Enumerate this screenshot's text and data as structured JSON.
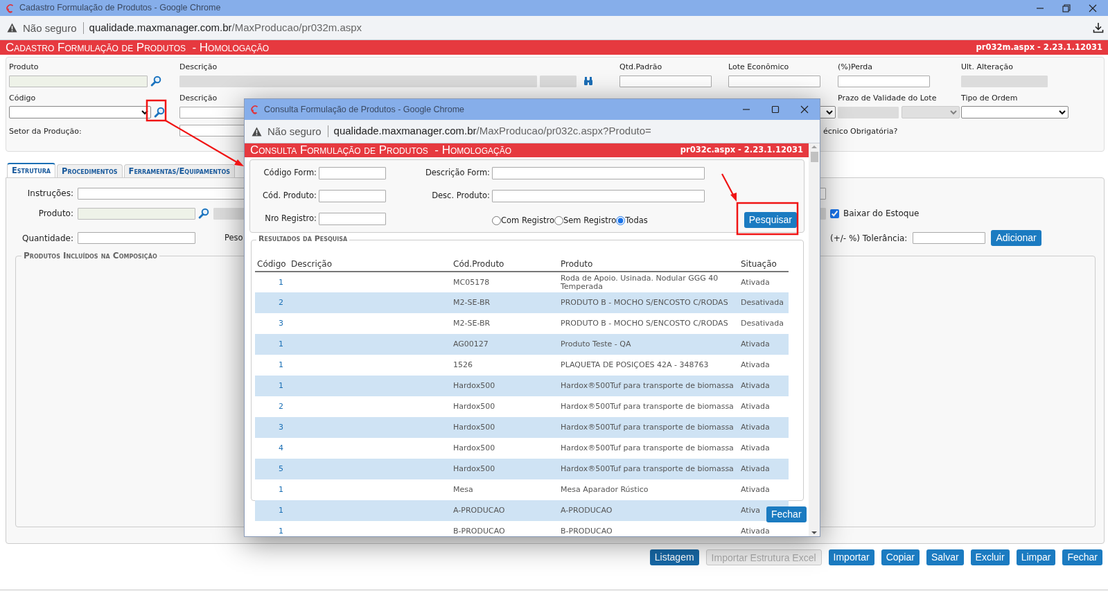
{
  "window": {
    "title": "Cadastro Formulação de Produtos - Google Chrome",
    "security": "Não seguro",
    "url_host": "qualidade.maxmanager.com.br",
    "url_path": "/MaxProducao/pr032m.aspx"
  },
  "page_header": {
    "title": "Cadastro Formulação de Produtos  - Homologação",
    "version": "pr032m.aspx - 2.23.1.12031"
  },
  "header_form": {
    "rows": [
      [
        {
          "label": "Produto",
          "kind": "lookup"
        },
        {
          "label": "Descrição",
          "kind": "readonly_pair"
        },
        {
          "label": "Qtd.Padrão",
          "kind": "text"
        },
        {
          "label": "Lote Econômico",
          "kind": "text"
        },
        {
          "label": "(%)Perda",
          "kind": "text"
        },
        {
          "label": "Ult. Alteração",
          "kind": "readonly"
        }
      ],
      [
        {
          "label": "Código",
          "kind": "select_lookup"
        },
        {
          "label": "Descrição",
          "kind": "text"
        },
        "",
        {
          "kind": "select"
        },
        {
          "label": "Prazo de Validade do Lote",
          "kind": "readonly_select"
        },
        {
          "label": "Tipo de Ordem",
          "kind": "select"
        }
      ]
    ],
    "setor_label": "Setor da Produção:",
    "partial_label": "écnico Obrigatória?"
  },
  "tabs": [
    {
      "label": "Estrutura",
      "selected": true
    },
    {
      "label": "Procedimentos",
      "selected": false
    },
    {
      "label": "Ferramentas/Equipamentos",
      "selected": false
    }
  ],
  "structure": {
    "instrucoes_label": "Instruções:",
    "produto_label": "Produto:",
    "quantidade_label": "Quantidade:",
    "peso_label": "Peso",
    "baixar": {
      "label": "Baixar do Estoque",
      "checked": true
    },
    "tolerancia_label": "(+/- %) Tolerância:",
    "add_button": "Adicionar",
    "composition_legend": "Produtos Incluídos na Composição"
  },
  "buttons": [
    {
      "label": "Listagem",
      "disabled": false,
      "focused": true
    },
    {
      "label": "Importar Estrutura Excel",
      "disabled": true,
      "focused": false
    },
    {
      "label": "Importar",
      "disabled": false,
      "focused": false
    },
    {
      "label": "Copiar",
      "disabled": false,
      "focused": false
    },
    {
      "label": "Salvar",
      "disabled": false,
      "focused": false
    },
    {
      "label": "Excluir",
      "disabled": false,
      "focused": false
    },
    {
      "label": "Limpar",
      "disabled": false,
      "focused": false
    },
    {
      "label": "Fechar",
      "disabled": false,
      "focused": false
    }
  ],
  "popup": {
    "title": "Consulta Formulação de Produtos - Google Chrome",
    "security": "Não seguro",
    "url_host": "qualidade.maxmanager.com.br",
    "url_path": "/MaxProducao/pr032c.aspx?Produto=",
    "header_title": "Consulta Formulação de Produtos  - Homologação",
    "version": "pr032c.aspx - 2.23.1.12031",
    "search_fields": [
      {
        "label": "Código Form:"
      },
      {
        "label": "Descrição Form:"
      },
      {
        "label": "Cód. Produto:"
      },
      {
        "label": "Desc. Produto:"
      },
      {
        "label": "Nro Registro:"
      }
    ],
    "filter_options": [
      {
        "label": "Com Registro",
        "selected": false
      },
      {
        "label": "Sem Registro",
        "selected": false
      },
      {
        "label": "Todas",
        "selected": true
      }
    ],
    "search_button": "Pesquisar",
    "results_legend": "Resultados da Pesquisa",
    "columns": [
      "Código",
      "Descrição",
      "Cód.Produto",
      "Produto",
      "Situação"
    ],
    "rows": [
      {
        "codigo": "1",
        "cod_produto": "MC05178",
        "produto": "Roda de Apoio. Usinada. Nodular GGG 40 Temperada",
        "situacao": "Ativada"
      },
      {
        "codigo": "2",
        "cod_produto": "M2-SE-BR",
        "produto": "PRODUTO B - MOCHO S/ENCOSTO C/RODAS",
        "situacao": "Desativada"
      },
      {
        "codigo": "3",
        "cod_produto": "M2-SE-BR",
        "produto": "PRODUTO B - MOCHO S/ENCOSTO C/RODAS",
        "situacao": "Desativada"
      },
      {
        "codigo": "1",
        "cod_produto": "AG00127",
        "produto": "Produto Teste - QA",
        "situacao": "Ativada"
      },
      {
        "codigo": "1",
        "cod_produto": "1526",
        "produto": "PLAQUETA DE POSIÇOES 42A - 348763",
        "situacao": "Ativada"
      },
      {
        "codigo": "1",
        "cod_produto": "Hardox500",
        "produto": "Hardox®500Tuf para transporte de biomassa",
        "situacao": "Ativada"
      },
      {
        "codigo": "2",
        "cod_produto": "Hardox500",
        "produto": "Hardox®500Tuf para transporte de biomassa",
        "situacao": "Ativada"
      },
      {
        "codigo": "3",
        "cod_produto": "Hardox500",
        "produto": "Hardox®500Tuf para transporte de biomassa",
        "situacao": "Ativada"
      },
      {
        "codigo": "4",
        "cod_produto": "Hardox500",
        "produto": "Hardox®500Tuf para transporte de biomassa",
        "situacao": "Ativada"
      },
      {
        "codigo": "5",
        "cod_produto": "Hardox500",
        "produto": "Hardox®500Tuf para transporte de biomassa",
        "situacao": "Ativada"
      },
      {
        "codigo": "1",
        "cod_produto": "Mesa",
        "produto": "Mesa Aparador Rústico",
        "situacao": "Ativada"
      },
      {
        "codigo": "1",
        "cod_produto": "A-PRODUCAO",
        "produto": "A-PRODUCAO",
        "situacao": "Ativa"
      },
      {
        "codigo": "1",
        "cod_produto": "B-PRODUCAO",
        "produto": "B-PRODUCAO",
        "situacao": "Ativada"
      }
    ],
    "close_button": "Fechar"
  }
}
